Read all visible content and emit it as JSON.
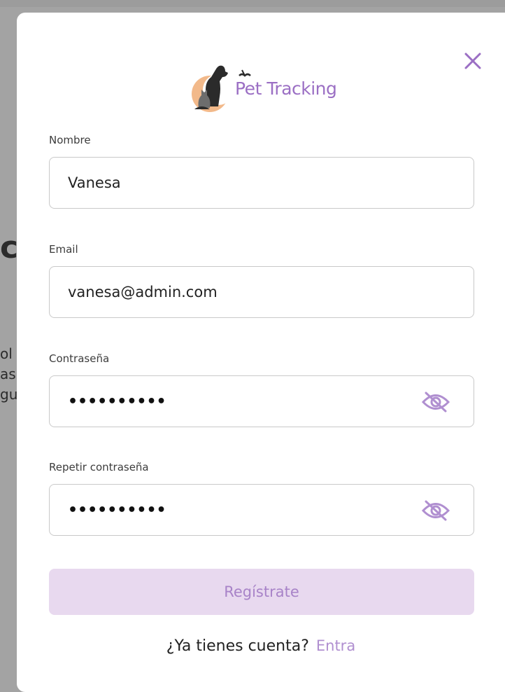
{
  "background": {
    "fragments": [
      "c",
      "ol",
      "as",
      "gu"
    ]
  },
  "modal": {
    "logo": {
      "text": "Pet Tracking",
      "icon": "pet-silhouette-logo-icon"
    },
    "close_icon": "close-icon",
    "fields": [
      {
        "label": "Nombre",
        "value": "Vanesa",
        "type": "text"
      },
      {
        "label": "Email",
        "value": "vanesa@admin.com",
        "type": "email"
      },
      {
        "label": "Contraseña",
        "masked": "••••••••••",
        "type": "password",
        "icon": "eye-slash-icon"
      },
      {
        "label": "Repetir contraseña",
        "masked": "••••••••••",
        "type": "password",
        "icon": "eye-slash-icon"
      }
    ],
    "submit_label": "Regístrate",
    "footer": {
      "prompt": "¿Ya tienes cuenta?",
      "link": "Entra"
    }
  },
  "colors": {
    "accent": "#9b6fc4",
    "button_bg": "#e8d9ef",
    "button_text": "#a883c8",
    "link": "#b08fd0",
    "overlay": "#9c9c9c"
  }
}
